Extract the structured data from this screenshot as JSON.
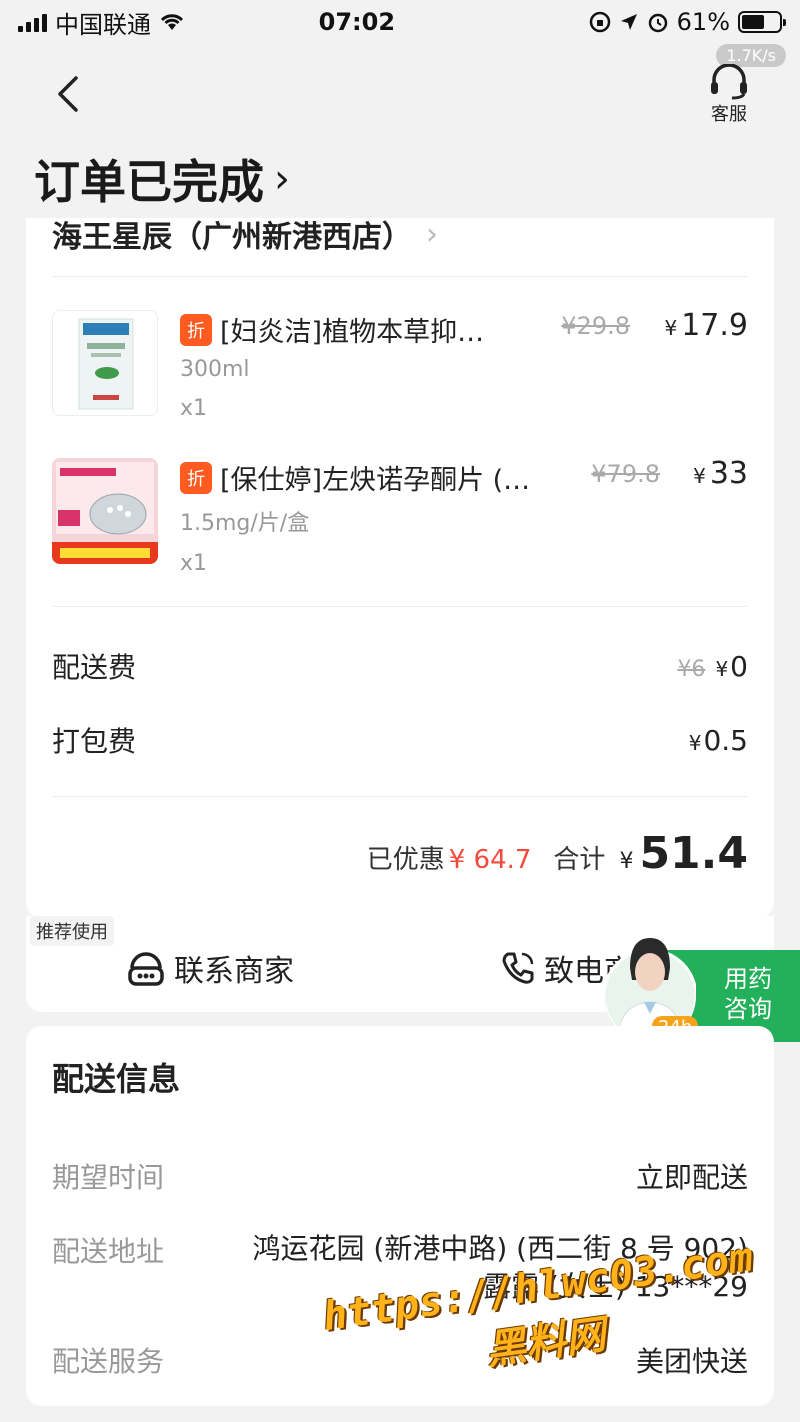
{
  "status_bar": {
    "carrier": "中国联通",
    "time": "07:02",
    "battery": "61%",
    "battery_level": 0.61,
    "net_speed": "1.7K/s"
  },
  "header": {
    "service_label": "客服",
    "title": "订单已完成",
    "title_chevron": "›"
  },
  "store": {
    "name": "海王星辰（广州新港西店）",
    "chevron": "›"
  },
  "products": [
    {
      "badge": "折",
      "title": "[妇炎洁]植物本草抑…",
      "spec": "300ml",
      "qty": "x1",
      "old_price": "¥29.8",
      "price_symbol": "¥",
      "price": "17.9"
    },
    {
      "badge": "折",
      "title": "[保仕婷]左炔诺孕酮片 (…",
      "spec": "1.5mg/片/盒",
      "qty": "x1",
      "old_price": "¥79.8",
      "price_symbol": "¥",
      "price": "33"
    }
  ],
  "fees": {
    "delivery": {
      "label": "配送费",
      "old": "¥6",
      "symbol": "¥",
      "value": "0"
    },
    "packing": {
      "label": "打包费",
      "symbol": "¥",
      "value": "0.5"
    }
  },
  "total": {
    "discount_label": "已优惠",
    "discount_value": "¥ 64.7",
    "total_label": "合计",
    "symbol": "¥",
    "total_value": "51.4"
  },
  "actions": {
    "recommend_tag": "推荐使用",
    "contact_merchant": "联系商家",
    "call_merchant": "致电商"
  },
  "consult": {
    "line1": "用药",
    "line2": "咨询",
    "badge": "24h"
  },
  "delivery_info": {
    "title": "配送信息",
    "rows": [
      {
        "label": "期望时间",
        "value": "立即配送"
      },
      {
        "label": "配送地址",
        "value": "鸿运花园 (新港中路) (西二街 8 号 902)",
        "value2": "露露 (女士) 13***29"
      },
      {
        "label": "配送服务",
        "value": "美团快送"
      }
    ]
  },
  "watermark": {
    "line1": "https://hlwc03.com",
    "line2": "黑料网"
  },
  "colors": {
    "accent_red": "#f24b3b",
    "badge_orange": "#ff5a1f",
    "consult_green": "#22b05a"
  }
}
